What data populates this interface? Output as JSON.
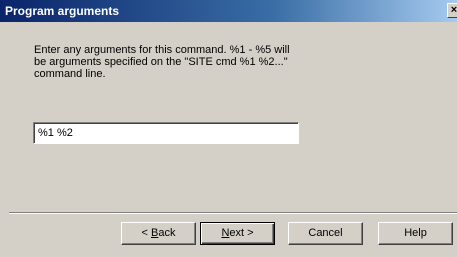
{
  "window": {
    "title": "Program arguments",
    "close_glyph": "×"
  },
  "description": {
    "line1": "Enter any arguments for this command.  %1 - %5 will",
    "line2": "be arguments specified on the \"SITE cmd %1 %2...\"",
    "line3": "command line."
  },
  "arguments_input": {
    "value": "%1 %2"
  },
  "buttons": {
    "back": {
      "prefix": "< ",
      "accel": "B",
      "rest": "ack"
    },
    "next": {
      "accel": "N",
      "rest": "ext >"
    },
    "cancel": "Cancel",
    "help": "Help"
  },
  "icons": {
    "close": "close-icon"
  }
}
